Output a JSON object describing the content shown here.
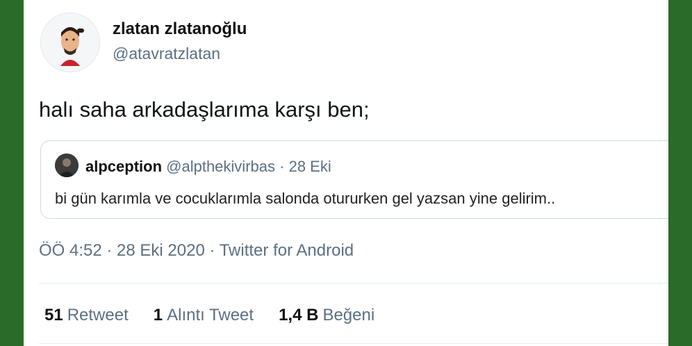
{
  "tweet": {
    "display_name": "zlatan zlatanoğlu",
    "handle": "@atavratzlatan",
    "text": "halı saha arkadaşlarıma karşı ben;",
    "timestamp": "ÖÖ 4:52 · 28 Eki 2020",
    "separator": "·",
    "source": "Twitter for Android"
  },
  "quoted_tweet": {
    "display_name": "alpception",
    "handle": "@alpthekivirbas",
    "separator": "·",
    "date": "28 Eki",
    "text": "bi gün karımla ve cocuklarımla salonda otururken gel yazsan yine gelirim.."
  },
  "stats": {
    "retweets_count": "51",
    "retweets_label": "Retweet",
    "quotes_count": "1",
    "quotes_label": "Alıntı Tweet",
    "likes_count": "1,4 B",
    "likes_label": "Beğeni"
  },
  "colors": {
    "background": "#2a6b2a",
    "card": "#ffffff",
    "secondary_text": "#5b7083",
    "border": "#cfd9de"
  }
}
